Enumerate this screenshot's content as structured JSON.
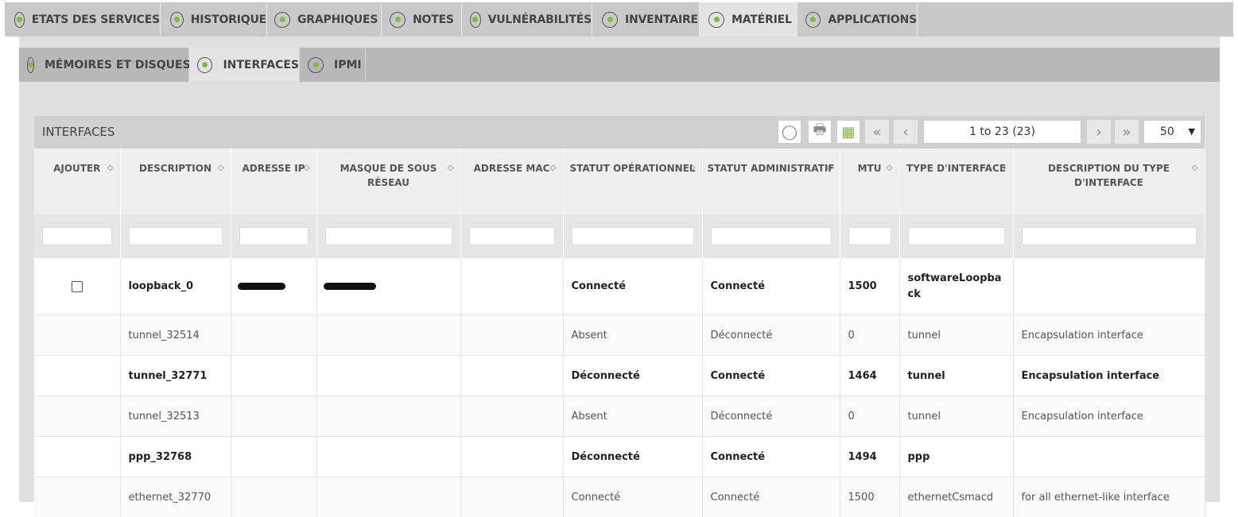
{
  "top_tabs": [
    {
      "label": "ETATS DES SERVICES",
      "icon": "heartbeat-icon",
      "active": false
    },
    {
      "label": "HISTORIQUE",
      "icon": "history-icon",
      "active": false
    },
    {
      "label": "GRAPHIQUES",
      "icon": "chart-icon",
      "active": false
    },
    {
      "label": "NOTES",
      "icon": "pencil-icon",
      "active": false
    },
    {
      "label": "VULNÉRABILITÉS",
      "icon": "bug-icon",
      "active": false
    },
    {
      "label": "INVENTAIRE",
      "icon": "database-icon",
      "active": false
    },
    {
      "label": "MATÉRIEL",
      "icon": "chip-icon",
      "active": true
    },
    {
      "label": "APPLICATIONS",
      "icon": "applications-icon",
      "active": false
    }
  ],
  "sub_tabs": [
    {
      "label": "MÉMOIRES ET DISQUES",
      "icon": "disk-icon",
      "active": false
    },
    {
      "label": "INTERFACES",
      "icon": "network-icon",
      "active": true
    },
    {
      "label": "IPMI",
      "icon": "ipmi-icon",
      "active": false
    }
  ],
  "table": {
    "title": "INTERFACES",
    "pagination": "1 to 23 (23)",
    "per_page": "50",
    "columns": [
      {
        "label": "AJOUTER"
      },
      {
        "label": "DESCRIPTION"
      },
      {
        "label": "ADRESSE IP"
      },
      {
        "label": "MASQUE DE SOUS RÉSEAU"
      },
      {
        "label": "ADRESSE MAC"
      },
      {
        "label": "STATUT OPÉRATIONNEL"
      },
      {
        "label": "STATUT ADMINISTRATIF"
      },
      {
        "label": "MTU"
      },
      {
        "label": "TYPE D'INTERFACE"
      },
      {
        "label": "DESCRIPTION DU TYPE D'INTERFACE"
      }
    ],
    "rows": [
      {
        "description": "loopback_0",
        "ip": "redacted",
        "mask": "redacted",
        "mac": "",
        "op_status": "Connecté",
        "admin_status": "Connecté",
        "mtu": "1500",
        "type": "softwareLoopback",
        "type_desc": "",
        "checkbox": true,
        "bold": true
      },
      {
        "description": "tunnel_32514",
        "ip": "",
        "mask": "",
        "mac": "",
        "op_status": "Absent",
        "admin_status": "Déconnecté",
        "mtu": "0",
        "type": "tunnel",
        "type_desc": "Encapsulation interface",
        "checkbox": false,
        "bold": false
      },
      {
        "description": "tunnel_32771",
        "ip": "",
        "mask": "",
        "mac": "",
        "op_status": "Déconnecté",
        "admin_status": "Connecté",
        "mtu": "1464",
        "type": "tunnel",
        "type_desc": "Encapsulation interface",
        "checkbox": false,
        "bold": true
      },
      {
        "description": "tunnel_32513",
        "ip": "",
        "mask": "",
        "mac": "",
        "op_status": "Absent",
        "admin_status": "Déconnecté",
        "mtu": "0",
        "type": "tunnel",
        "type_desc": "Encapsulation interface",
        "checkbox": false,
        "bold": false
      },
      {
        "description": "ppp_32768",
        "ip": "",
        "mask": "",
        "mac": "",
        "op_status": "Déconnecté",
        "admin_status": "Connecté",
        "mtu": "1494",
        "type": "ppp",
        "type_desc": "",
        "checkbox": false,
        "bold": true
      },
      {
        "description": "ethernet_32770",
        "ip": "",
        "mask": "",
        "mac": "",
        "op_status": "Connecté",
        "admin_status": "Connecté",
        "mtu": "1500",
        "type": "ethernetCsmacd",
        "type_desc": "for all ethernet-like interface",
        "checkbox": false,
        "bold": false
      }
    ]
  },
  "colors": {
    "accent_green": "#7bbd3f",
    "tab_bar": "#c9c9c9",
    "sub_tab_bar": "#b8b8b8"
  }
}
